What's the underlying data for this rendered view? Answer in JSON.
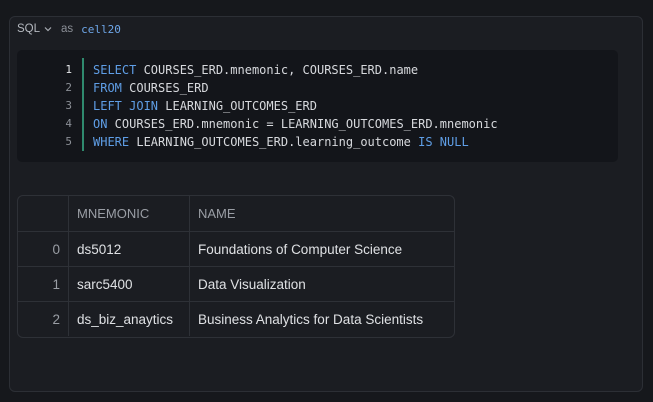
{
  "cell": {
    "language": "SQL",
    "as_label": "as",
    "name": "cell20"
  },
  "editor": {
    "line_numbers": [
      "1",
      "2",
      "3",
      "4",
      "5"
    ],
    "lines": [
      [
        {
          "t": "SELECT",
          "kw": true
        },
        {
          "t": " COURSES_ERD.mnemonic, COURSES_ERD.name",
          "kw": false
        }
      ],
      [
        {
          "t": "FROM",
          "kw": true
        },
        {
          "t": " COURSES_ERD",
          "kw": false
        }
      ],
      [
        {
          "t": "LEFT JOIN",
          "kw": true
        },
        {
          "t": " LEARNING_OUTCOMES_ERD",
          "kw": false
        }
      ],
      [
        {
          "t": "ON",
          "kw": true
        },
        {
          "t": " COURSES_ERD.mnemonic = LEARNING_OUTCOMES_ERD.mnemonic",
          "kw": false
        }
      ],
      [
        {
          "t": "WHERE",
          "kw": true
        },
        {
          "t": " LEARNING_OUTCOMES_ERD.learning_outcome ",
          "kw": false
        },
        {
          "t": "IS NULL",
          "kw": true
        }
      ]
    ]
  },
  "result": {
    "columns": [
      "",
      "MNEMONIC",
      "NAME"
    ],
    "rows": [
      [
        "0",
        "ds5012",
        "Foundations of Computer Science"
      ],
      [
        "1",
        "sarc5400",
        "Data Visualization"
      ],
      [
        "2",
        "ds_biz_anaytics",
        "Business Analytics for Data Scientists"
      ]
    ]
  },
  "colors": {
    "keyword": "#5f9ee6",
    "edit_bar": "#2f8a6e",
    "cell_name": "#6ea6e8"
  }
}
